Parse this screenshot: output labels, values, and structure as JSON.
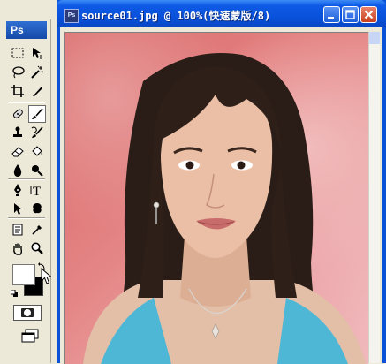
{
  "toolbox": {
    "logo_label": "Ps",
    "tools": [
      {
        "name": "marquee-tool-icon"
      },
      {
        "name": "move-tool-icon"
      },
      {
        "name": "lasso-tool-icon"
      },
      {
        "name": "magic-wand-tool-icon"
      },
      {
        "name": "crop-tool-icon"
      },
      {
        "name": "slice-tool-icon"
      },
      {
        "name": "healing-brush-tool-icon"
      },
      {
        "name": "brush-tool-icon",
        "selected": true
      },
      {
        "name": "clone-stamp-tool-icon"
      },
      {
        "name": "history-brush-tool-icon"
      },
      {
        "name": "eraser-tool-icon"
      },
      {
        "name": "paint-bucket-tool-icon"
      },
      {
        "name": "blur-tool-icon"
      },
      {
        "name": "dodge-tool-icon"
      },
      {
        "name": "pen-tool-icon"
      },
      {
        "name": "type-tool-icon"
      },
      {
        "name": "path-selection-tool-icon"
      },
      {
        "name": "custom-shape-tool-icon"
      },
      {
        "name": "notes-tool-icon"
      },
      {
        "name": "eyedropper-tool-icon"
      },
      {
        "name": "hand-tool-icon"
      },
      {
        "name": "zoom-tool-icon"
      }
    ],
    "foreground_color": "#ffffff",
    "background_color": "#000000"
  },
  "document": {
    "title": "source01.jpg @ 100%(快速蒙版/8)",
    "title_icon_label": "Ps",
    "mask_overlay_color": "#e07070"
  }
}
